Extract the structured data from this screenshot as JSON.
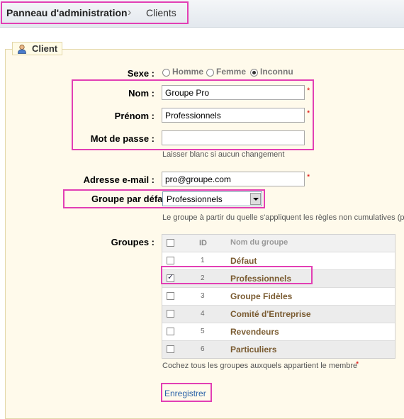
{
  "breadcrumb": {
    "main": "Panneau d'administration",
    "separator": "›",
    "current": "Clients"
  },
  "form": {
    "legend": "Client",
    "gender": {
      "label": "Sexe :",
      "options": [
        "Homme",
        "Femme",
        "Inconnu"
      ],
      "selected": "Inconnu"
    },
    "lastname": {
      "label": "Nom :",
      "value": "Groupe Pro"
    },
    "firstname": {
      "label": "Prénom :",
      "value": "Professionnels"
    },
    "password": {
      "label": "Mot de passe :",
      "value": "",
      "hint": "Laisser blanc si aucun changement"
    },
    "email": {
      "label": "Adresse e-mail :",
      "value": "pro@groupe.com"
    },
    "default_group": {
      "label": "Groupe par défaut:",
      "value": "Professionnels",
      "hint": "Le groupe à partir du quelle s'appliquent les règles non cumulatives (pa"
    },
    "groups": {
      "label": "Groupes :",
      "header": {
        "id": "ID",
        "name": "Nom du groupe"
      },
      "rows": [
        {
          "id": "1",
          "name": "Défaut",
          "checked": false
        },
        {
          "id": "2",
          "name": "Professionnels",
          "checked": true
        },
        {
          "id": "3",
          "name": "Groupe Fidèles",
          "checked": false
        },
        {
          "id": "4",
          "name": "Comité d'Entreprise",
          "checked": false
        },
        {
          "id": "5",
          "name": "Revendeurs",
          "checked": false
        },
        {
          "id": "6",
          "name": "Particuliers",
          "checked": false
        }
      ],
      "hint": "Cochez tous les groupes auxquels appartient le membre"
    },
    "required_mark": "*",
    "save_label": "Enregistrer"
  },
  "colors": {
    "highlight": "#e23fb4",
    "fieldset_bg": "#fffaeb",
    "group_name": "#7a5b31",
    "link": "#2a62a8"
  }
}
